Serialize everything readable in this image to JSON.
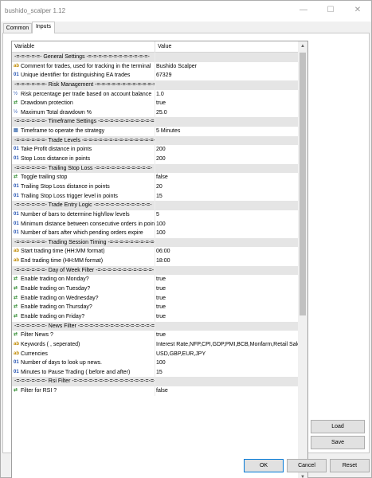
{
  "window": {
    "title": "bushido_scalper 1.12",
    "minimize_glyph": "—",
    "maximize_glyph": "☐",
    "close_glyph": "✕"
  },
  "tabs": [
    {
      "label": "Common",
      "active": false
    },
    {
      "label": "Inputs",
      "active": true
    }
  ],
  "table": {
    "headers": {
      "variable": "Variable",
      "value": "Value"
    },
    "rows": [
      {
        "type": "section",
        "variable": "-=-=-=-=-=- General Settings -=-=-=-=-=-=-=-=-=-=-=-=-"
      },
      {
        "type": "string",
        "variable": "Comment for trades, used for tracking in the terminal",
        "value": "Bushido Scalper"
      },
      {
        "type": "int",
        "variable": "Unique identifier for distinguishing EA trades",
        "value": "67329"
      },
      {
        "type": "section",
        "variable": "-=-=-=-=-=-=- Risk Management -=-=-=-=-=-=-=-=-=-=-=-=-"
      },
      {
        "type": "double",
        "variable": "Risk percentage per trade based on account balance",
        "value": "1.0"
      },
      {
        "type": "bool",
        "variable": "Drawdown protection",
        "value": "true"
      },
      {
        "type": "double",
        "variable": "Maximum Total drawdown %",
        "value": "25.0"
      },
      {
        "type": "section",
        "variable": "-=-=-=-=-=-=- Timeframe Settings -=-=-=-=-=-=-=-=-=-=-=-"
      },
      {
        "type": "enum",
        "variable": "Timeframe to operate the strategy",
        "value": "5 Minutes"
      },
      {
        "type": "section",
        "variable": "-=-=-=-=-=-=- Trade Levels -=-=-=-=-=-=-=-=-=-=-=-=-=-=-"
      },
      {
        "type": "int",
        "variable": "Take Profit distance in points",
        "value": "200"
      },
      {
        "type": "int",
        "variable": "Stop Loss distance in points",
        "value": "200"
      },
      {
        "type": "section",
        "variable": "-=-=-=-=-=-=- Trailing Stop Loss -=-=-=-=-=-=-=-=-=-=-=-"
      },
      {
        "type": "bool",
        "variable": "Toggle trailing stop",
        "value": "false"
      },
      {
        "type": "int",
        "variable": "Trailing Stop Loss distance in points",
        "value": "20"
      },
      {
        "type": "int",
        "variable": "Trailing Stop Loss trigger level in points",
        "value": "15"
      },
      {
        "type": "section",
        "variable": "-=-=-=-=-=-=- Trade Entry Logic -=-=-=-=-=-=-=-=-=-=-=-"
      },
      {
        "type": "int",
        "variable": "Number of bars to determine high/low levels",
        "value": "5"
      },
      {
        "type": "int",
        "variable": "Minimum distance between consecutive orders in points",
        "value": "100"
      },
      {
        "type": "int",
        "variable": "Number of bars after which pending orders expire",
        "value": "100"
      },
      {
        "type": "section",
        "variable": "-=-=-=-=-=-=- Trading Session Timing -=-=-=-=-=-=-=-=-=-"
      },
      {
        "type": "string",
        "variable": "Start trading time (HH:MM format)",
        "value": "06:00"
      },
      {
        "type": "string",
        "variable": "End trading time (HH:MM format)",
        "value": "18:00"
      },
      {
        "type": "section",
        "variable": "-=-=-=-=-=-=- Day of Week Filter -=-=-=-=-=-=-=-=-=-=-=-"
      },
      {
        "type": "bool",
        "variable": "Enable trading on Monday?",
        "value": "true"
      },
      {
        "type": "bool",
        "variable": "Enable trading on Tuesday?",
        "value": "true"
      },
      {
        "type": "bool",
        "variable": "Enable trading on Wednesday?",
        "value": "true"
      },
      {
        "type": "bool",
        "variable": "Enable trading on Thursday?",
        "value": "true"
      },
      {
        "type": "bool",
        "variable": "Enable trading on Friday?",
        "value": "true"
      },
      {
        "type": "section",
        "variable": "-=-=-=-=-=-=- News Filter -=-=-=-=-=-=-=-=-=-=-=-=-=-=-=-"
      },
      {
        "type": "bool",
        "variable": "Filter News ?",
        "value": "true"
      },
      {
        "type": "string",
        "variable": "Keywords ( , seperated)",
        "value": "Interest Rate,NFP,CPI,GDP,PMI,BCB,Monfarm,Retail Sales"
      },
      {
        "type": "string",
        "variable": "Currencies",
        "value": "USD,GBP,EUR,JPY"
      },
      {
        "type": "int",
        "variable": "Number of days to look up news.",
        "value": "100"
      },
      {
        "type": "int",
        "variable": "Minutes to Pause Trading ( before and after)",
        "value": "15"
      },
      {
        "type": "section",
        "variable": "-=-=-=-=-=-=- Rsi Filter -=-=-=-=-=-=-=-=-=-=-=-=-=-=-=-=-"
      },
      {
        "type": "bool",
        "variable": "Filter for RSI ?",
        "value": "false"
      }
    ]
  },
  "type_icons": {
    "string": {
      "glyph": "ab",
      "name": "string-type-icon"
    },
    "int": {
      "glyph": "01",
      "name": "integer-type-icon"
    },
    "double": {
      "glyph": "½",
      "name": "double-type-icon"
    },
    "bool": {
      "glyph": "⇄",
      "name": "boolean-type-icon"
    },
    "enum": {
      "glyph": "▤",
      "name": "enum-type-icon"
    }
  },
  "buttons": {
    "load": "Load",
    "save": "Save",
    "ok": "OK",
    "cancel": "Cancel",
    "reset": "Reset"
  }
}
